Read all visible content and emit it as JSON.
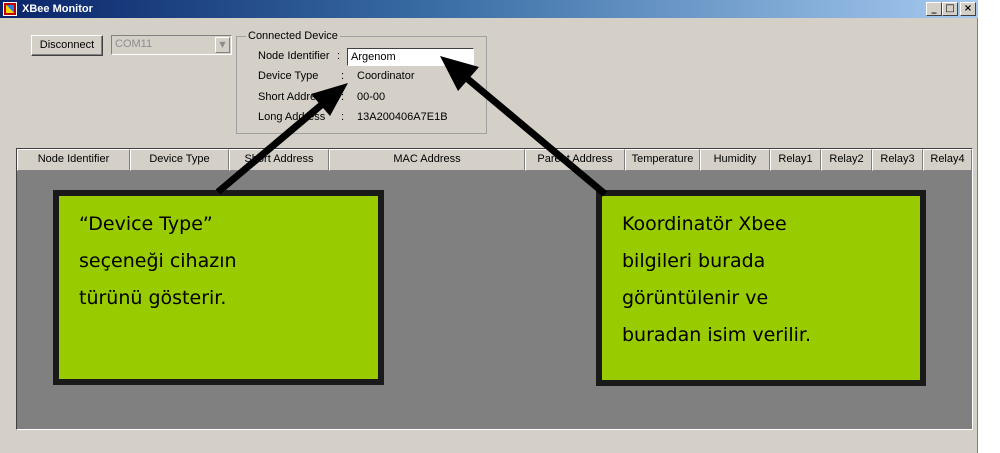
{
  "window": {
    "title": "XBee Monitor",
    "controls": {
      "minimize": "_",
      "maximize": "□",
      "close": "×"
    }
  },
  "toolbar": {
    "disconnect_label": "Disconnect",
    "port_value": "COM11",
    "port_arrow": "▼"
  },
  "connected_device": {
    "legend": "Connected Device",
    "node_identifier_label": "Node Identifier",
    "node_identifier_value": "Argenom",
    "device_type_label": "Device Type",
    "device_type_value": "Coordinator",
    "short_address_label": "Short Address",
    "short_address_value": "00-00",
    "long_address_label": "Long Address",
    "long_address_value": "13A200406A7E1B",
    "separator": ":"
  },
  "device_list": {
    "columns": [
      "Node Identifier",
      "Device Type",
      "Short Address",
      "MAC Address",
      "Parent Address",
      "Temperature",
      "Humidity",
      "Relay1",
      "Relay2",
      "Relay3",
      "Relay4"
    ],
    "rows": []
  },
  "callouts": {
    "device_type": [
      "“Device Type”",
      "seçeneği cihazın",
      "türünü gösterir."
    ],
    "coordinator": [
      "Koordinatör Xbee",
      "bilgileri burada",
      "görüntülenir ve",
      "buradan isim verilir."
    ]
  },
  "colors": {
    "callout_fill": "#99cc00",
    "callout_border": "#1a1a1a",
    "list_background": "#808080",
    "window_background": "#d4d0c8",
    "titlebar_start": "#0a246a"
  }
}
